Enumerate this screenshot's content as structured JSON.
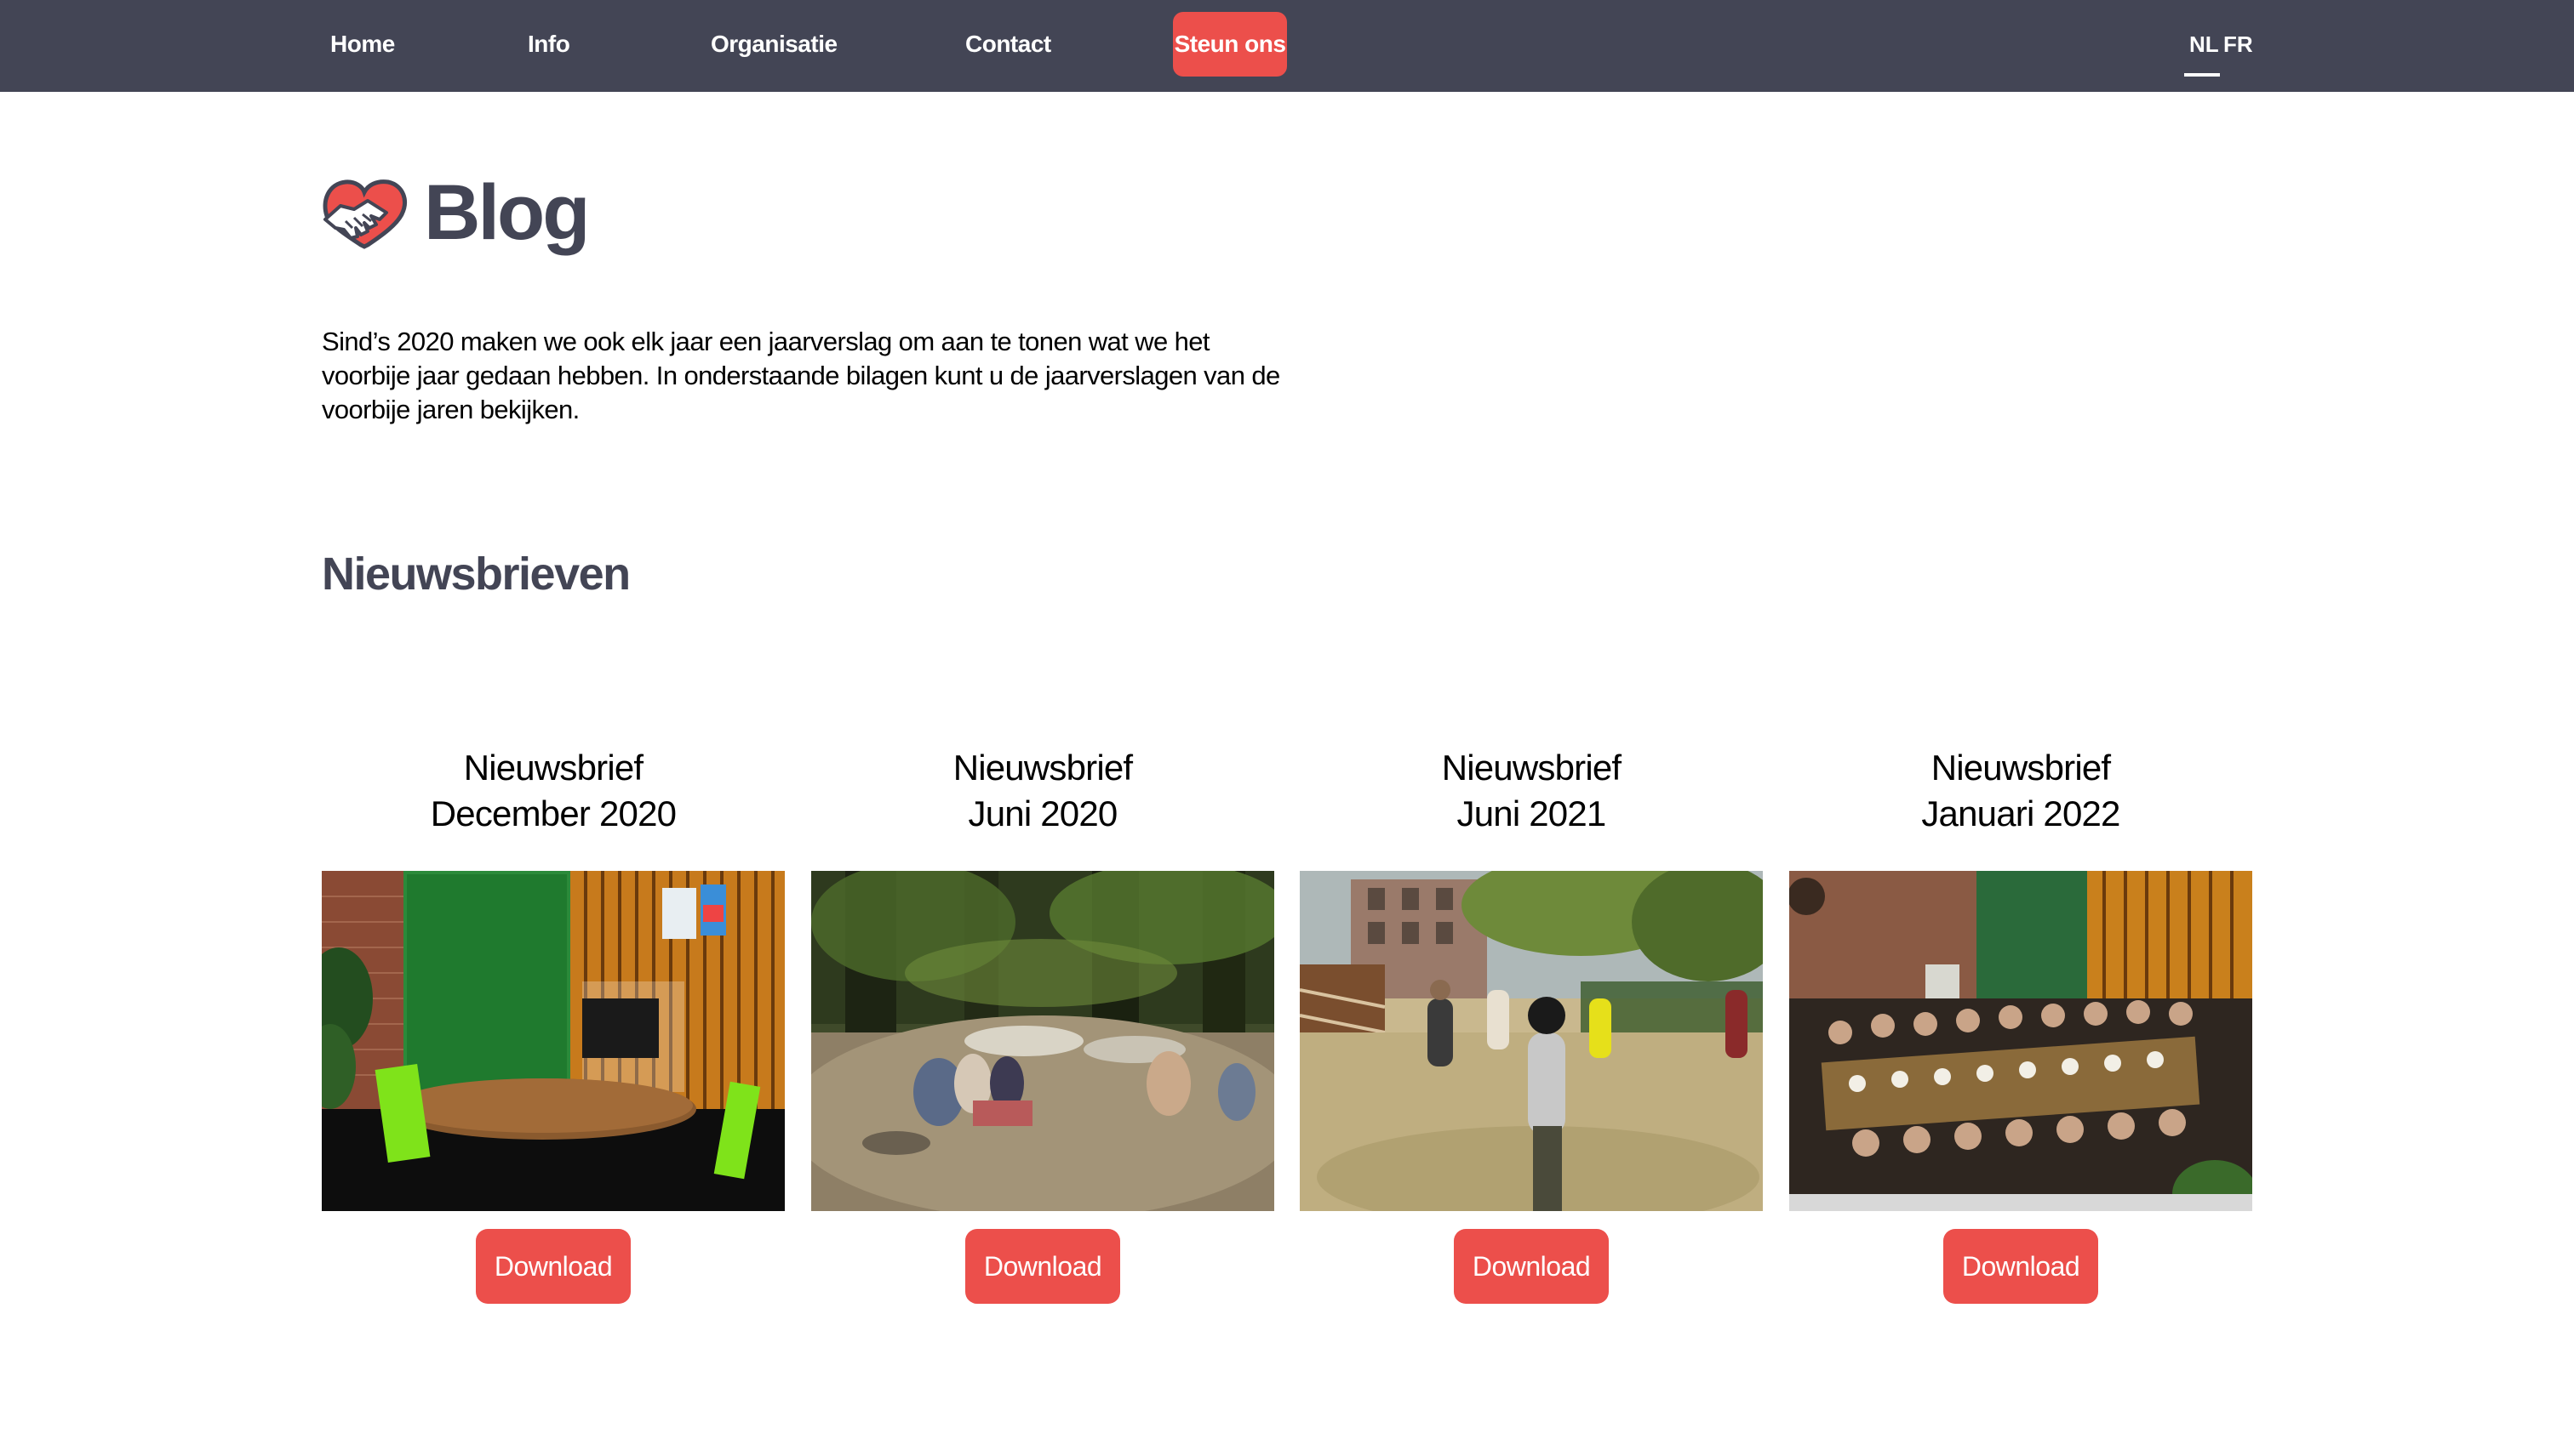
{
  "nav": {
    "items": [
      "Home",
      "Info",
      "Organisatie",
      "Contact"
    ],
    "cta": "Steun ons",
    "languages": [
      "NL",
      "FR"
    ],
    "active_language": "NL"
  },
  "header": {
    "title": "Blog",
    "logo_icon": "handshake-heart-icon"
  },
  "intro": "Sind’s 2020 maken we ook elk jaar een jaarverslag om aan te tonen wat we het voorbije jaar gedaan hebben. In onderstaande bilagen kunt u de jaarverslagen van de voorbije jaren bekijken.",
  "section": {
    "title": "Nieuwsbrieven"
  },
  "newsletters": [
    {
      "title_line1": "Nieuwsbrief",
      "title_line2": "December 2020",
      "button": "Download"
    },
    {
      "title_line1": "Nieuwsbrief",
      "title_line2": "Juni 2020",
      "button": "Download"
    },
    {
      "title_line1": "Nieuwsbrief",
      "title_line2": "Juni 2021",
      "button": "Download"
    },
    {
      "title_line1": "Nieuwsbrief",
      "title_line2": "Januari 2022",
      "button": "Download"
    }
  ],
  "colors": {
    "nav_bg": "#434555",
    "accent": "#ec4f4b",
    "heading": "#434555"
  }
}
